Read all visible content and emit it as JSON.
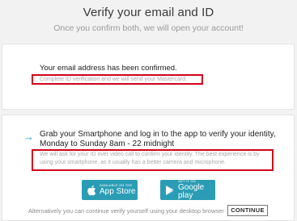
{
  "header": {
    "title": "Verify your email and ID",
    "subtitle": "Once you confirm both, we will open your account!"
  },
  "email_card": {
    "status": "Your email address has been confirmed.",
    "next_step": "Complete ID verification and we will send your Mastercard."
  },
  "id_card": {
    "instruction": "Grab your Smartphone and log in to the app to verify your identity, Monday to Sunday 8am - 22 midnight",
    "video_call_text": "We will ask for your ID over video call to confirm your identity. The best experience is by using your smartphone, as it usually has a better camera and microphone.",
    "app_store": {
      "small_label": "AVAILABLE ON THE",
      "big_label": "App Store"
    },
    "google_play": {
      "small_label": "GET IT ON",
      "big_label": "Google play"
    },
    "alternative_text": "Alternatively you can continue verify yourself using your desktop browser",
    "continue_label": "CONTINUE"
  },
  "colors": {
    "accent": "#2a9db5",
    "highlight": "#d0021b",
    "background": "#f2f2f2"
  },
  "icons": {
    "arrow": "arrow-right-icon",
    "apple": "apple-icon",
    "google_play": "google-play-icon"
  }
}
